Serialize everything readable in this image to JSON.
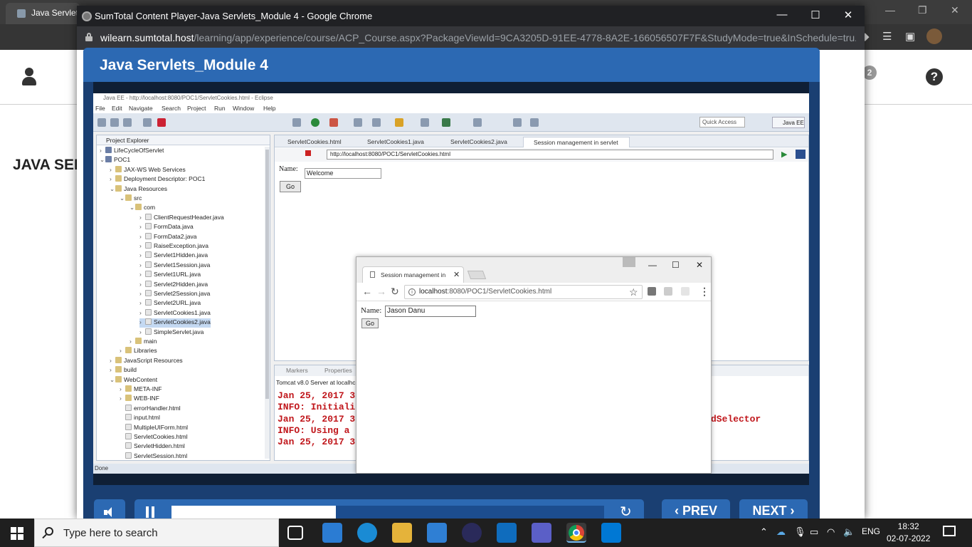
{
  "background_window": {
    "tab_title": "Java Servlets",
    "page_title": "JAVA SER",
    "badge_count": "2",
    "help_glyph": "?"
  },
  "popup": {
    "window_title": "SumTotal Content Player-Java Servlets_Module 4 - Google Chrome",
    "url_host": "wilearn.sumtotal.host",
    "url_path": "/learning/app/experience/course/ACP_Course.aspx?PackageViewId=9CA3205D-91EE-4778-8A2E-166056507F7F&StudyMode=true&InSchedule=tru..."
  },
  "player": {
    "title": "Java Servlets_Module 4",
    "progress_fraction": 0.38,
    "prev_label": "PREV",
    "next_label": "NEXT"
  },
  "eclipse": {
    "window_title": "Java EE - http://localhost:8080/POC1/ServletCookies.html - Eclipse",
    "menu": [
      "File",
      "Edit",
      "Navigate",
      "Search",
      "Project",
      "Run",
      "Window",
      "Help"
    ],
    "quick_access": "Quick Access",
    "perspective": "Java EE",
    "project_explorer_tab": "Project Explorer",
    "tree": [
      {
        "label": "LifeCycleOfServlet",
        "depth": 0,
        "twisty": ">"
      },
      {
        "label": "POC1",
        "depth": 0,
        "twisty": "v"
      },
      {
        "label": "JAX-WS Web Services",
        "depth": 1,
        "twisty": ">"
      },
      {
        "label": "Deployment Descriptor: POC1",
        "depth": 1,
        "twisty": ">"
      },
      {
        "label": "Java Resources",
        "depth": 1,
        "twisty": "v"
      },
      {
        "label": "src",
        "depth": 2,
        "twisty": "v"
      },
      {
        "label": "com",
        "depth": 3,
        "twisty": "v"
      },
      {
        "label": "ClientRequestHeader.java",
        "depth": 4,
        "twisty": ">"
      },
      {
        "label": "FormData.java",
        "depth": 4,
        "twisty": ">"
      },
      {
        "label": "FormData2.java",
        "depth": 4,
        "twisty": ">"
      },
      {
        "label": "RaiseException.java",
        "depth": 4,
        "twisty": ">"
      },
      {
        "label": "Servlet1Hidden.java",
        "depth": 4,
        "twisty": ">"
      },
      {
        "label": "Servlet1Session.java",
        "depth": 4,
        "twisty": ">"
      },
      {
        "label": "Servlet1URL.java",
        "depth": 4,
        "twisty": ">"
      },
      {
        "label": "Servlet2Hidden.java",
        "depth": 4,
        "twisty": ">"
      },
      {
        "label": "Servlet2Session.java",
        "depth": 4,
        "twisty": ">"
      },
      {
        "label": "Servlet2URL.java",
        "depth": 4,
        "twisty": ">"
      },
      {
        "label": "ServletCookies1.java",
        "depth": 4,
        "twisty": ">"
      },
      {
        "label": "ServletCookies2.java",
        "depth": 4,
        "twisty": ">",
        "selected": true
      },
      {
        "label": "SimpleServlet.java",
        "depth": 4,
        "twisty": ">"
      },
      {
        "label": "main",
        "depth": 3,
        "twisty": ">"
      },
      {
        "label": "Libraries",
        "depth": 2,
        "twisty": ">"
      },
      {
        "label": "JavaScript Resources",
        "depth": 1,
        "twisty": ">"
      },
      {
        "label": "build",
        "depth": 1,
        "twisty": ">"
      },
      {
        "label": "WebContent",
        "depth": 1,
        "twisty": "v"
      },
      {
        "label": "META-INF",
        "depth": 2,
        "twisty": ">"
      },
      {
        "label": "WEB-INF",
        "depth": 2,
        "twisty": ">"
      },
      {
        "label": "errorHandler.html",
        "depth": 2,
        "twisty": ""
      },
      {
        "label": "input.html",
        "depth": 2,
        "twisty": ""
      },
      {
        "label": "MultipleUIForm.html",
        "depth": 2,
        "twisty": ""
      },
      {
        "label": "ServletCookies.html",
        "depth": 2,
        "twisty": ""
      },
      {
        "label": "ServletHidden.html",
        "depth": 2,
        "twisty": ""
      },
      {
        "label": "ServletSession.html",
        "depth": 2,
        "twisty": ""
      }
    ],
    "editor_tabs": [
      "ServletCookies.html",
      "ServletCookies1.java",
      "ServletCookies2.java",
      "Session management in servlet"
    ],
    "editor_url": "http://localhost:8080/POC1/ServletCookies.html",
    "name_label": "Name:",
    "name_value": "Welcome",
    "go_label": "Go",
    "console_tabs": [
      "Markers",
      "Properties"
    ],
    "console_head": "Tomcat v8.0 Server at localhc",
    "console_lines": [
      "Jan 25, 2017 3",
      "INFO: Initiali",
      "Jan 25, 2017 3",
      "INFO: Using a",
      "Jan 25, 2017 3"
    ],
    "console_fragment": "dSelector",
    "status": "Done"
  },
  "inner_chrome": {
    "tab_title": "Session management in",
    "url_host": "localhost",
    "url_rest": ":8080/POC1/ServletCookies.html",
    "name_label": "Name:",
    "name_value": "Jason Danu",
    "go_label": "Go"
  },
  "taskbar": {
    "search_placeholder": "Type here to search",
    "language": "ENG",
    "time": "18:32",
    "date": "02-07-2022"
  }
}
